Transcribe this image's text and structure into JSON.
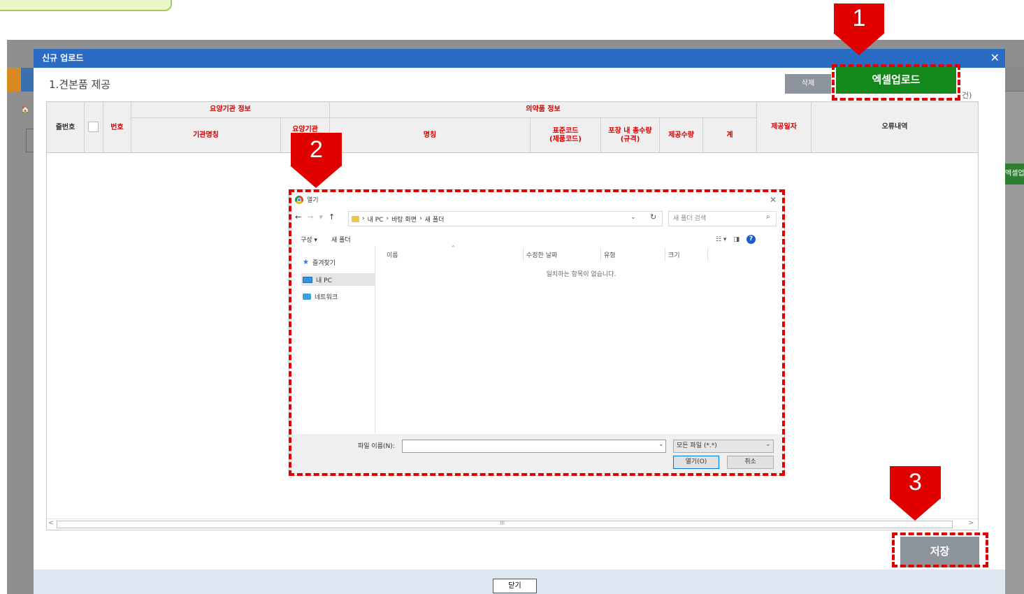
{
  "background": {
    "left_icon_text": "🏠 ",
    "right_excel_sliver": "엑셀업"
  },
  "modal": {
    "title": "신규 업로드",
    "close_glyph": "✕",
    "section_title": "1.견본품 제공",
    "delete_label": "삭제",
    "excel_upload_label": "엑셀업로드",
    "right_note": "건)",
    "save_label": "저장",
    "close_label": "닫기"
  },
  "grid": {
    "group_headers": {
      "institution_info": "요양기관 정보",
      "drug_info": "의약품 정보"
    },
    "columns": {
      "row_no": "줄번호",
      "number": "번호",
      "institution_name": "기관명칭",
      "institution_code": "요양기관",
      "drug_name": "명칭",
      "standard_code_1": "표준코드",
      "standard_code_2": "(제품코드)",
      "pack_qty_1": "포장 내 총수량",
      "pack_qty_2": "(규격)",
      "provided_qty": "제공수량",
      "total": "계",
      "provided_date": "제공일자",
      "error_log": "오류내역"
    },
    "scrollbar_grip": "III"
  },
  "file_dialog": {
    "title": "열기",
    "path": [
      "내 PC",
      "바탕 화면",
      "새 폴더"
    ],
    "search_placeholder": "새 폴더 검색",
    "toolbar": {
      "organize": "구성 ▾",
      "new_folder": "새 폴더"
    },
    "sidebar": [
      "즐겨찾기",
      "내 PC",
      "네트워크"
    ],
    "columns": [
      "이름",
      "수정한 날짜",
      "유형",
      "크기"
    ],
    "empty_message": "일치하는 항목이 없습니다.",
    "filename_label": "파일 이름(N):",
    "filetype": "모든 파일 (*.*)",
    "open_label": "열기(O)",
    "cancel_label": "취소"
  },
  "markers": [
    "1",
    "2",
    "3"
  ],
  "colors": {
    "modal_header": "#2a6cc4",
    "excel_button": "#14881a",
    "callout_red": "#e00000",
    "grid_header_text": "#d30000"
  },
  "icons": {
    "chrome": "chrome-icon",
    "folder": "folder-icon",
    "star": "star-icon",
    "pc": "pc-icon",
    "network": "network-icon",
    "help": "help-icon"
  }
}
